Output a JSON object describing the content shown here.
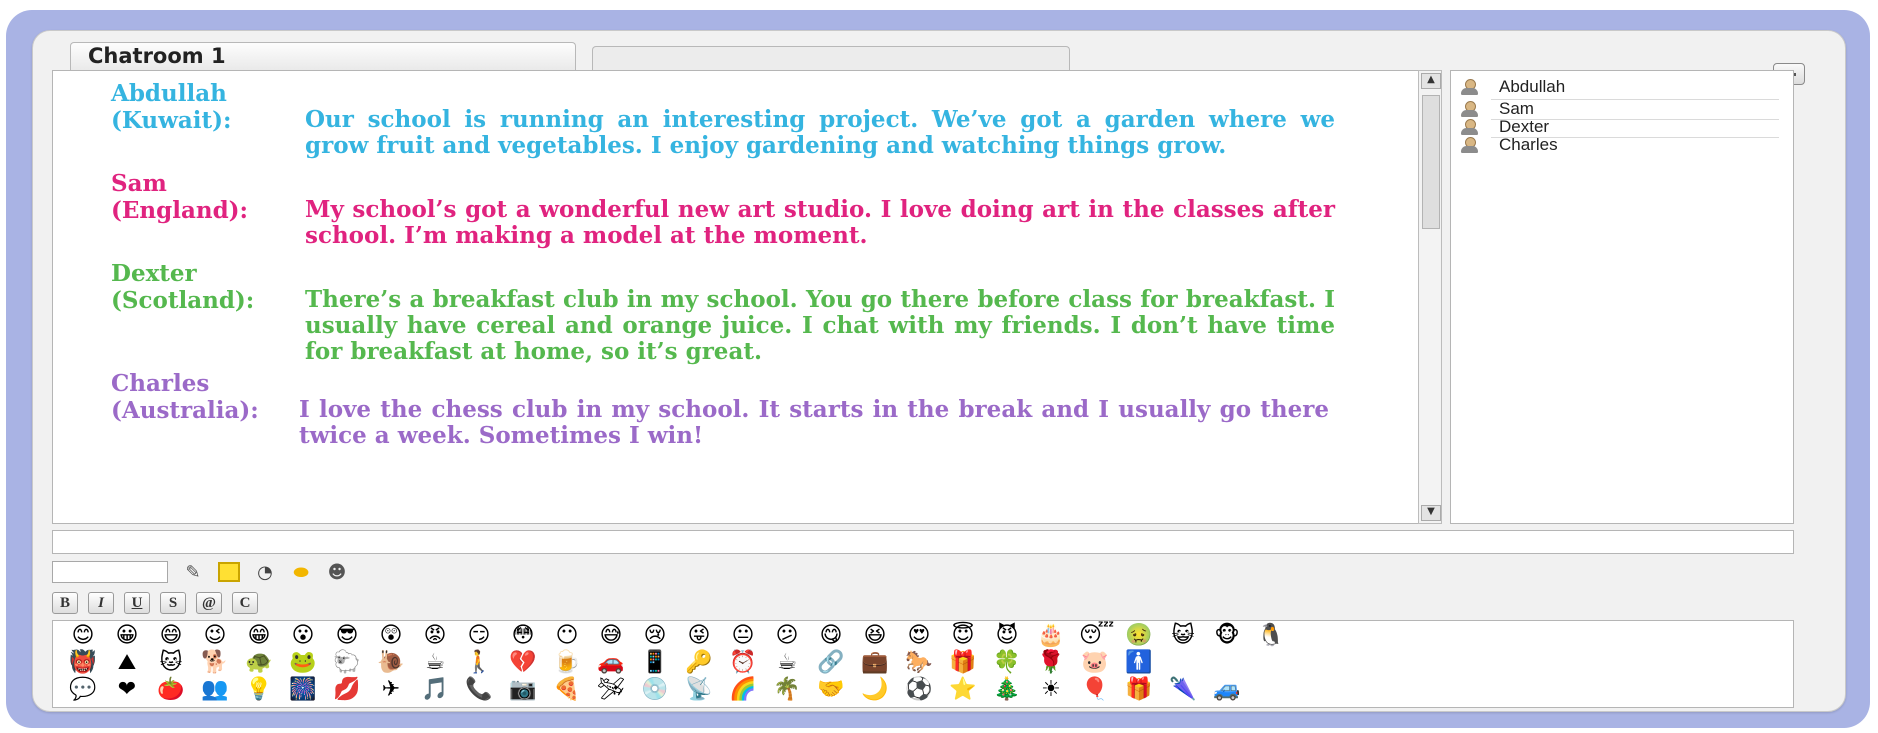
{
  "window": {
    "tabs": [
      {
        "label": "Chatroom 1",
        "active": true
      },
      {
        "label": "",
        "active": false
      }
    ]
  },
  "chat": {
    "messages": [
      {
        "sender": "Abdullah",
        "origin": "(Kuwait):",
        "color": "#35b4e0",
        "text": "Our school is running an interesting project. We’ve got a garden where we grow fruit and vegetables. I enjoy gardening and watching things grow."
      },
      {
        "sender": "Sam",
        "origin": "(England):",
        "color": "#e0237f",
        "text": "My school’s got a wonderful new art studio. I love doing art in the classes after school. I’m making a model at the moment."
      },
      {
        "sender": "Dexter",
        "origin": "(Scotland):",
        "color": "#55b84e",
        "text": "There’s a breakfast club in my school. You go there before class for breakfast. I usually have cereal and orange juice. I chat with my friends. I don’t have time for breakfast at home, so it’s great."
      },
      {
        "sender": "Charles",
        "origin": "(Australia):",
        "color": "#9b6ac8",
        "text": "I love the chess club in my school. It starts in the break and I usually go there twice a week. Sometimes I win!"
      }
    ]
  },
  "users": [
    "Abdullah",
    "Sam",
    "Dexter",
    "Charles"
  ],
  "toolbar": {
    "icons": [
      "pen-icon",
      "color-square-icon",
      "clock-icon",
      "flash-icon",
      "contact-icon"
    ],
    "format_buttons": [
      "B",
      "I",
      "U",
      "S",
      "@",
      "C"
    ]
  },
  "emoticons": {
    "row1": [
      "😊",
      "😀",
      "😄",
      "😉",
      "😁",
      "😮",
      "😎",
      "😲",
      "😡",
      "😏",
      "😳",
      "😶",
      "😅",
      "😢",
      "😜",
      "😐",
      "😕",
      "😋",
      "😆",
      "😍",
      "😇",
      "😈",
      "🎂",
      "😴",
      "🤢",
      "😺",
      "🐵",
      "🐧"
    ],
    "row2": [
      "👹",
      "⛰",
      "🐱",
      "🐕",
      "🐢",
      "🐸",
      "🐑",
      "🐌",
      "☕",
      "🚶",
      "💔",
      "🍺",
      "🚗",
      "📱",
      "🔑",
      "⏰",
      "☕",
      "🔗",
      "💼",
      "🐎",
      "🎁",
      "🍀",
      "🌹",
      "🐷",
      "🚹"
    ],
    "row3": [
      "💬",
      "❤",
      "🍅",
      "👥",
      "💡",
      "🎆",
      "💋",
      "✈",
      "🎵",
      "📞",
      "📷",
      "🍕",
      "🛩",
      "💿",
      "📡",
      "🌈",
      "🌴",
      "🤝",
      "🌙",
      "⚽",
      "⭐",
      "🎄",
      "☀",
      "🎈",
      "🎁",
      "🌂",
      "🚙"
    ]
  }
}
